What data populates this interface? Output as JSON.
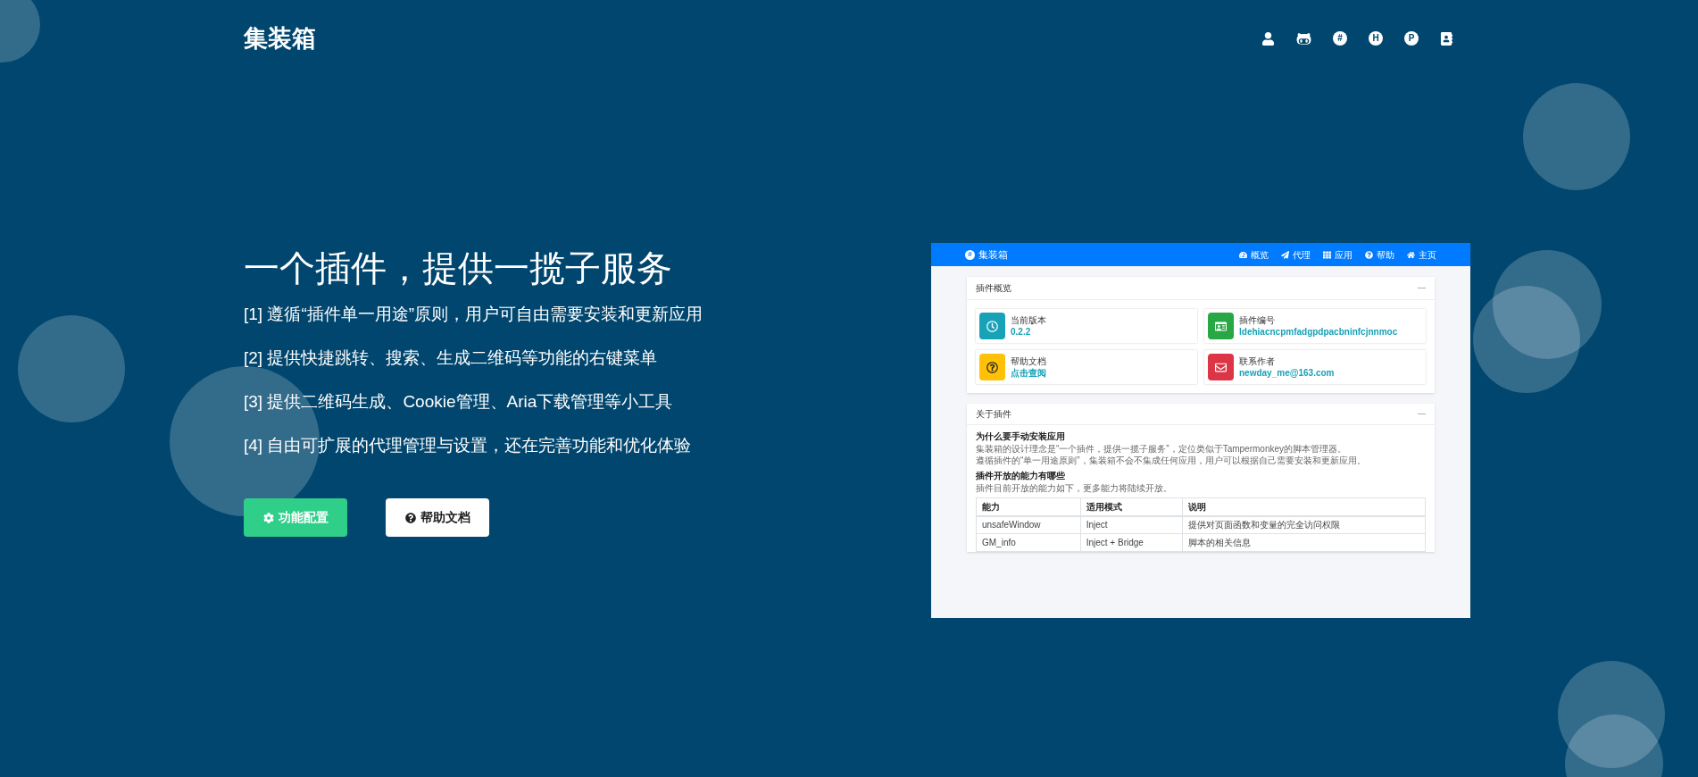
{
  "header": {
    "brand": "集装箱",
    "icons": [
      {
        "kind": "user"
      },
      {
        "kind": "github"
      },
      {
        "kind": "letter",
        "text": "#"
      },
      {
        "kind": "letter",
        "text": "H"
      },
      {
        "kind": "letter",
        "text": "P"
      },
      {
        "kind": "contacts"
      }
    ]
  },
  "hero": {
    "title": "一个插件，提供一揽子服务",
    "points": [
      "[1] 遵循“插件单一用途”原则，用户可自由需要安装和更新应用",
      "[2] 提供快捷跳转、搜索、生成二维码等功能的右键菜单",
      "[3] 提供二维码生成、Cookie管理、Aria下载管理等小工具",
      "[4] 自由可扩展的代理管理与设置，还在完善功能和优化体验"
    ],
    "buttons": [
      {
        "kind": "primary",
        "label": "功能配置"
      },
      {
        "kind": "secondary",
        "label": "帮助文档"
      }
    ]
  },
  "preview": {
    "logo": "#",
    "brand": "集装箱",
    "nav": [
      {
        "kind": "dashboard",
        "label": "概览"
      },
      {
        "kind": "plane",
        "label": "代理"
      },
      {
        "kind": "grid",
        "label": "应用"
      },
      {
        "kind": "help",
        "label": "帮助"
      },
      {
        "kind": "home",
        "label": "主页"
      }
    ],
    "overview": {
      "title": "插件概览",
      "toggle": "—",
      "items": [
        {
          "kind": "clock",
          "color": "#17a2b8",
          "label": "当前版本",
          "value": "0.2.2"
        },
        {
          "kind": "card",
          "color": "#28a745",
          "label": "插件编号",
          "value": "ldehiacncpmfadgpdpacbninfcjnnmoc"
        },
        {
          "kind": "help",
          "color": "#ffc107",
          "label": "帮助文档",
          "value": "点击查阅"
        },
        {
          "kind": "mail",
          "color": "#dc3545",
          "label": "联系作者",
          "value": "newday_me@163.com"
        }
      ]
    },
    "about": {
      "title": "关于插件",
      "toggle": "—",
      "q1": "为什么要手动安装应用",
      "p1": [
        "集装箱的设计理念是“一个插件，提供一揽子服务”，定位类似于Tampermonkey的脚本管理器。",
        "遵循插件的“单一用途原则”，集装箱不会不集成任何应用，用户可以根据自己需要安装和更新应用。"
      ],
      "q2": "插件开放的能力有哪些",
      "p2": "插件目前开放的能力如下，更多能力将陆续开放。",
      "table": {
        "columns": [
          "能力",
          "适用模式",
          "说明"
        ],
        "rows": [
          [
            "unsafeWindow",
            "Inject",
            "提供对页面函数和变量的完全访问权限"
          ],
          [
            "GM_info",
            "Inject + Bridge",
            "脚本的相关信息"
          ]
        ]
      }
    }
  }
}
